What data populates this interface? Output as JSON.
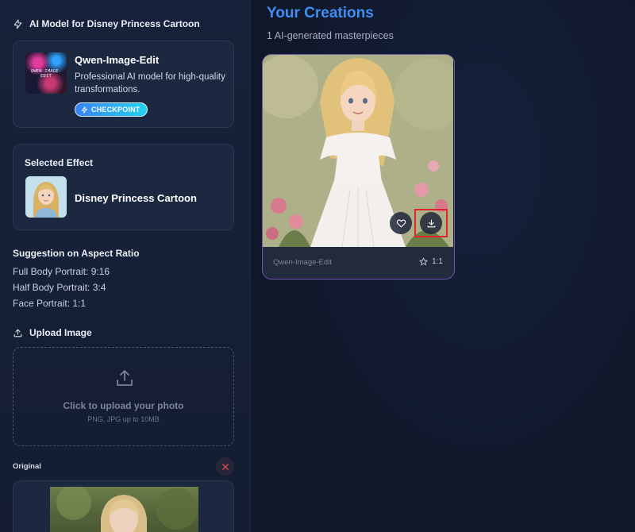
{
  "sidebar": {
    "model_section_title": "AI Model for Disney Princess Cartoon",
    "model": {
      "name": "Qwen-Image-Edit",
      "description": "Professional AI model for high-quality transformations.",
      "badge": "CHECKPOINT",
      "thumb_text": "QWEN-IMAGE-EDIT"
    },
    "effect": {
      "title": "Selected Effect",
      "name": "Disney Princess Cartoon"
    },
    "aspect_ratio": {
      "title": "Suggestion on Aspect Ratio",
      "lines": [
        "Full Body Portrait: 9:16",
        "Half Body Portrait: 3:4",
        "Face Portrait: 1:1"
      ]
    },
    "upload": {
      "title": "Upload Image",
      "main_text": "Click to upload your photo",
      "sub_text": "PNG, JPG up to 10MB"
    },
    "original": {
      "label": "Original"
    }
  },
  "main": {
    "title": "Your Creations",
    "subtitle": "1 AI-generated masterpieces",
    "creation": {
      "model": "Qwen-Image-Edit",
      "ratio": "1:1"
    }
  },
  "colors": {
    "accent_blue": "#3d8ff5",
    "badge_start": "#3b82f6",
    "badge_end": "#22d3ee",
    "card_border": "#6c5aa8",
    "highlight": "#e0262a",
    "background": "#0f1729"
  },
  "icons": {
    "model_section": "lightning-icon",
    "badge": "lightning-icon",
    "upload_section": "upload-icon",
    "upload_box": "upload-arrow-icon",
    "close": "close-icon",
    "favorite": "heart-icon",
    "download": "download-icon",
    "ratio": "star-icon"
  }
}
